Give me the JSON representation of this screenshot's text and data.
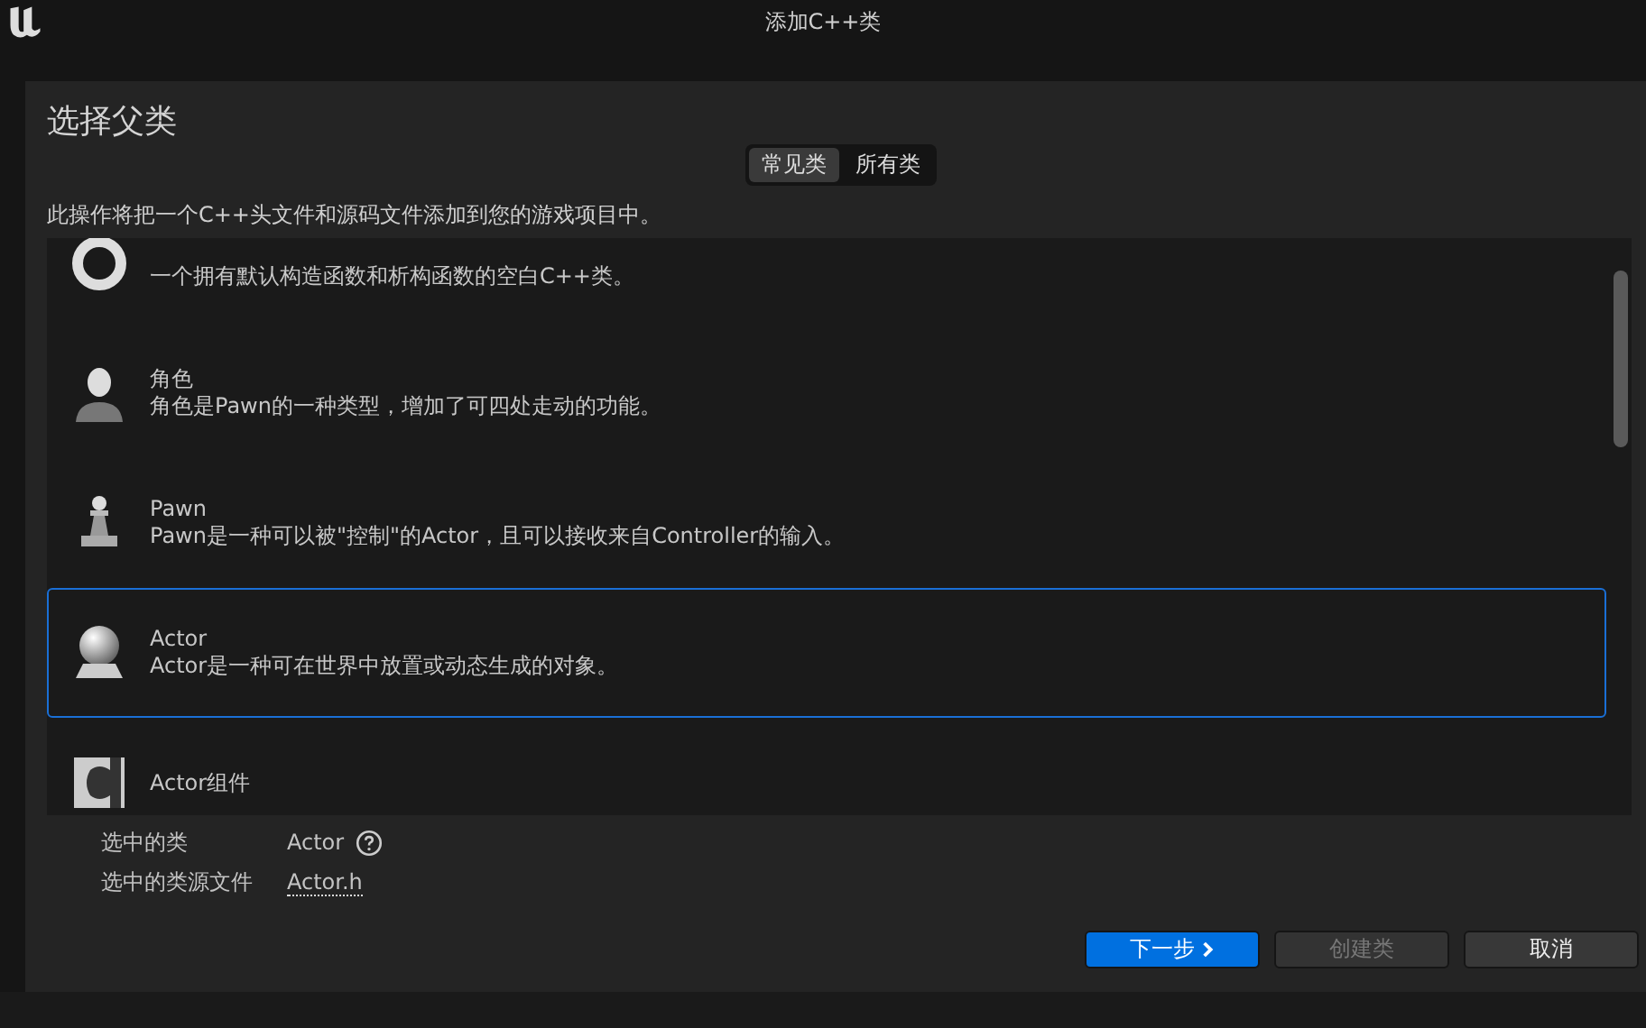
{
  "window": {
    "title": "添加C++类"
  },
  "heading": "选择父类",
  "tabs": [
    {
      "label": "常见类",
      "selected": true
    },
    {
      "label": "所有类",
      "selected": false
    }
  ],
  "description": "此操作将把一个C++头文件和源码文件添加到您的游戏项目中。",
  "classes": [
    {
      "kind": "empty",
      "description": "一个拥有默认构造函数和析构函数的空白C++类。",
      "selected": false
    },
    {
      "kind": "character",
      "title": "角色",
      "description": "角色是Pawn的一种类型，增加了可四处走动的功能。",
      "selected": false
    },
    {
      "kind": "pawn",
      "title": "Pawn",
      "description": "Pawn是一种可以被\"控制\"的Actor，且可以接收来自Controller的输入。",
      "selected": false
    },
    {
      "kind": "actor",
      "title": "Actor",
      "description": "Actor是一种可在世界中放置或动态生成的对象。",
      "selected": true
    },
    {
      "kind": "component",
      "title": "Actor组件",
      "selected": false
    }
  ],
  "selection": {
    "class_label": "选中的类",
    "class_value": "Actor",
    "source_label": "选中的类源文件",
    "source_value": "Actor.h"
  },
  "buttons": [
    {
      "label": "下一步",
      "kind": "primary",
      "disabled": false
    },
    {
      "label": "创建类",
      "kind": "normal",
      "disabled": true
    },
    {
      "label": "取消",
      "kind": "normal",
      "disabled": false
    }
  ]
}
